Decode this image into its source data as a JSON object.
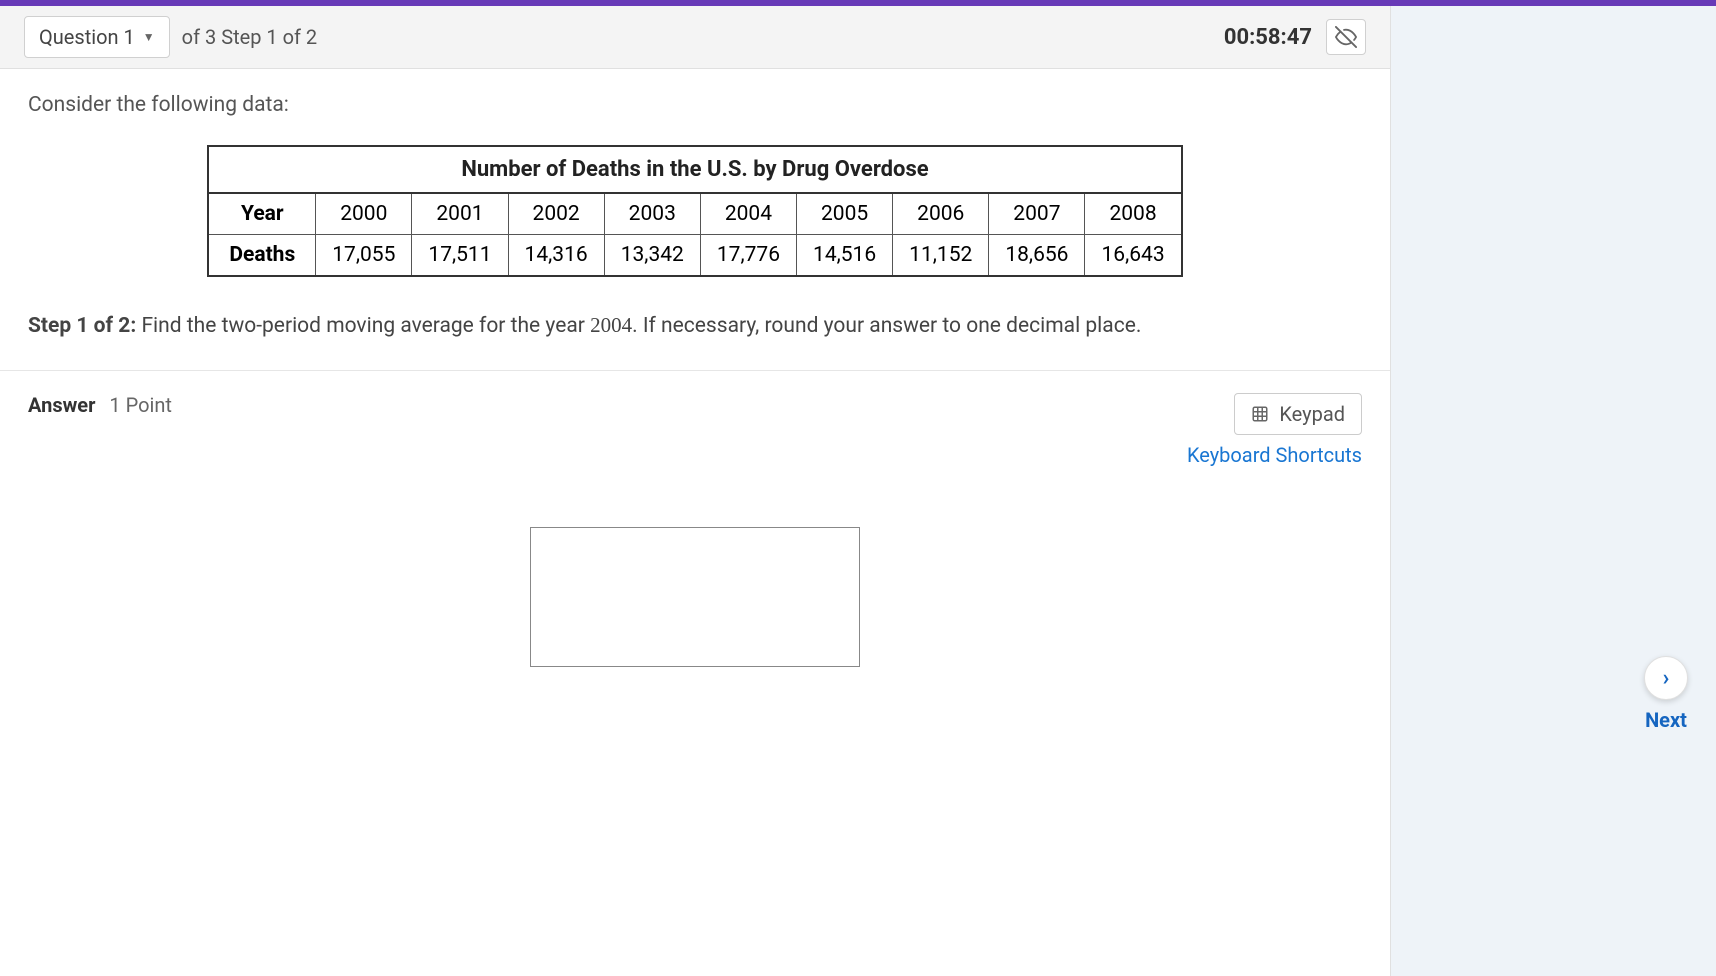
{
  "header": {
    "question_label": "Question 1",
    "step_text": "of 3 Step 1 of 2",
    "timer": "00:58:47"
  },
  "question": {
    "intro": "Consider the following data:",
    "table_title": "Number of Deaths in the U.S. by Drug Overdose",
    "row_labels": {
      "year": "Year",
      "deaths": "Deaths"
    },
    "years": [
      "2000",
      "2001",
      "2002",
      "2003",
      "2004",
      "2005",
      "2006",
      "2007",
      "2008"
    ],
    "deaths": [
      "17,055",
      "17,511",
      "14,316",
      "13,342",
      "17,776",
      "14,516",
      "11,152",
      "18,656",
      "16,643"
    ],
    "step_label": "Step 1 of 2:",
    "step_body_1": " Find the two-period moving average for the year ",
    "step_year": "2004",
    "step_body_2": ". If necessary, round your answer to one decimal place."
  },
  "answer": {
    "label": "Answer",
    "points": "1 Point",
    "keypad": "Keypad",
    "shortcuts": "Keyboard Shortcuts",
    "value": ""
  },
  "nav": {
    "next": "Next"
  }
}
